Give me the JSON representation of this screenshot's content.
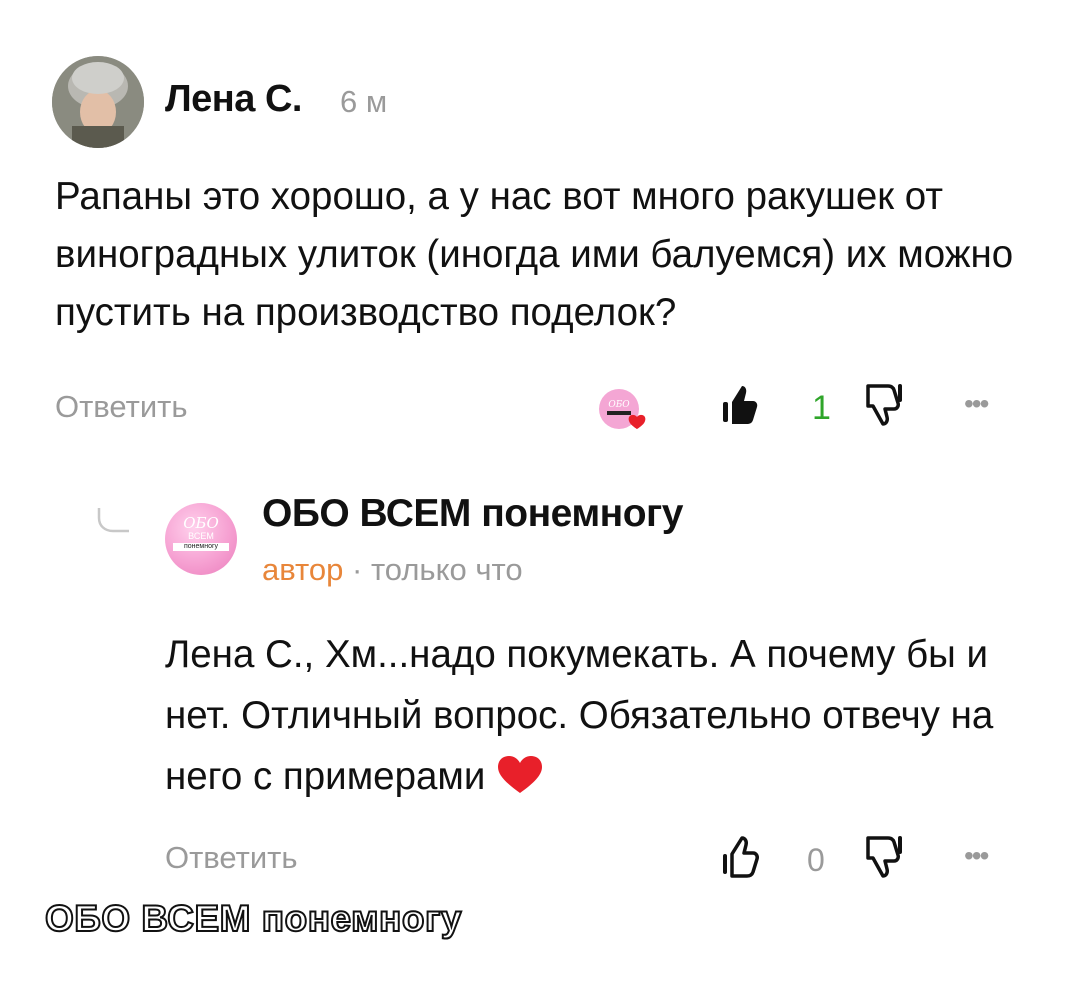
{
  "comment": {
    "author": "Лена С.",
    "time": "6 м",
    "text": "Рапаны это хорошо, а у нас вот много ракушек от виноградных улиток (иногда ими балуемся) их можно пустить на производство поделок?",
    "reply_label": "Ответить",
    "like_count": "1",
    "more_label": "•••",
    "author_heart_avatar_text": "ОБО"
  },
  "reply": {
    "author": "ОБО ВСЕМ понемногу",
    "badge": "автор",
    "separator": " · ",
    "time": "только что",
    "text": "Лена С., Хм...надо покумекать. А почему бы и нет. Отличный вопрос. Обязательно отвечу на него с примерами",
    "reply_label": "Ответить",
    "like_count": "0",
    "more_label": "•••",
    "avatar_text_line1": "ОБО",
    "avatar_text_line2": "ВСЕМ",
    "avatar_text_line3": "понемногу"
  },
  "watermark": "ОБО ВСЕМ понемногу",
  "colors": {
    "author_badge": "#e8863a",
    "like_count_active": "#2fa52a",
    "muted": "#9a9a9a",
    "heart": "#e8202a"
  },
  "icons": {
    "like": "thumbs-up-icon",
    "dislike": "thumbs-down-icon",
    "more": "more-dots-icon",
    "heart": "heart-icon",
    "thread": "thread-line-icon"
  }
}
